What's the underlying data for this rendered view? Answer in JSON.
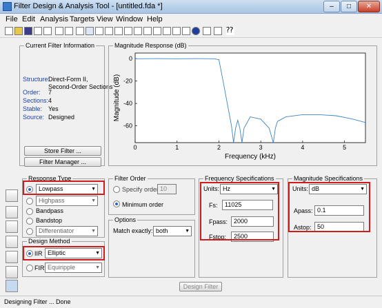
{
  "window": {
    "title": "Filter Design & Analysis Tool -  [untitled.fda *]"
  },
  "menu": [
    "File",
    "Edit",
    "Analysis",
    "Targets",
    "View",
    "Window",
    "Help"
  ],
  "filter_info": {
    "legend": "Current Filter Information",
    "rows": [
      {
        "label": "Structure:",
        "value": "Direct-Form II,\nSecond-Order Sections"
      },
      {
        "label": "Order:",
        "value": "7"
      },
      {
        "label": "Sections:",
        "value": "4"
      },
      {
        "label": "Stable:",
        "value": "Yes"
      },
      {
        "label": "Source:",
        "value": "Designed"
      }
    ],
    "store_label": "Store Filter ...",
    "manager_label": "Filter Manager ..."
  },
  "chart_data": {
    "type": "line",
    "title": "Magnitude Response (dB)",
    "xlabel": "Frequency (kHz)",
    "ylabel": "Magnitude (dB)",
    "xlim": [
      0,
      5.5
    ],
    "ylim": [
      -75,
      5
    ],
    "xticks": [
      0,
      1,
      2,
      3,
      4,
      5
    ],
    "yticks": [
      0,
      -20,
      -40,
      -60
    ],
    "series": [
      {
        "x": [
          0,
          0.5,
          1,
          1.5,
          1.9,
          2.0,
          2.1,
          2.2,
          2.3,
          2.35,
          2.4,
          2.45,
          2.5,
          2.55,
          2.6,
          2.75,
          3.0,
          3.2,
          3.3,
          3.35,
          3.4,
          3.6,
          4.0,
          4.4,
          4.8,
          5.2,
          5.5
        ],
        "y": [
          -0.1,
          0,
          -0.1,
          0,
          -0.1,
          -1,
          -20,
          -40,
          -60,
          -75,
          -62,
          -55,
          -62,
          -75,
          -62,
          -52,
          -54,
          -62,
          -75,
          -62,
          -56,
          -52,
          -50,
          -50,
          -51,
          -54,
          -57
        ]
      }
    ]
  },
  "response_type": {
    "legend": "Response Type",
    "options": [
      "Lowpass",
      "Highpass",
      "Bandpass",
      "Bandstop",
      "Differentiator"
    ]
  },
  "design_method": {
    "legend": "Design Method",
    "iir_label": "IIR",
    "iir_value": "Elliptic",
    "fir_label": "FIR",
    "fir_value": "Equiripple"
  },
  "filter_order": {
    "legend": "Filter Order",
    "specify_label": "Specify order:",
    "specify_value": "10",
    "minimum_label": "Minimum order"
  },
  "options": {
    "legend": "Options",
    "match_label": "Match exactly:",
    "match_value": "both"
  },
  "freq_specs": {
    "legend": "Frequency Specifications",
    "units_label": "Units:",
    "units_value": "Hz",
    "fs_label": "Fs:",
    "fs_value": "11025",
    "fpass_label": "Fpass:",
    "fpass_value": "2000",
    "fstop_label": "Fstop:",
    "fstop_value": "2500"
  },
  "mag_specs": {
    "legend": "Magnitude Specifications",
    "units_label": "Units:",
    "units_value": "dB",
    "apass_label": "Apass:",
    "apass_value": "0.1",
    "astop_label": "Astop:",
    "astop_value": "50"
  },
  "design_button": "Design Filter",
  "status": "Designing Filter ... Done"
}
